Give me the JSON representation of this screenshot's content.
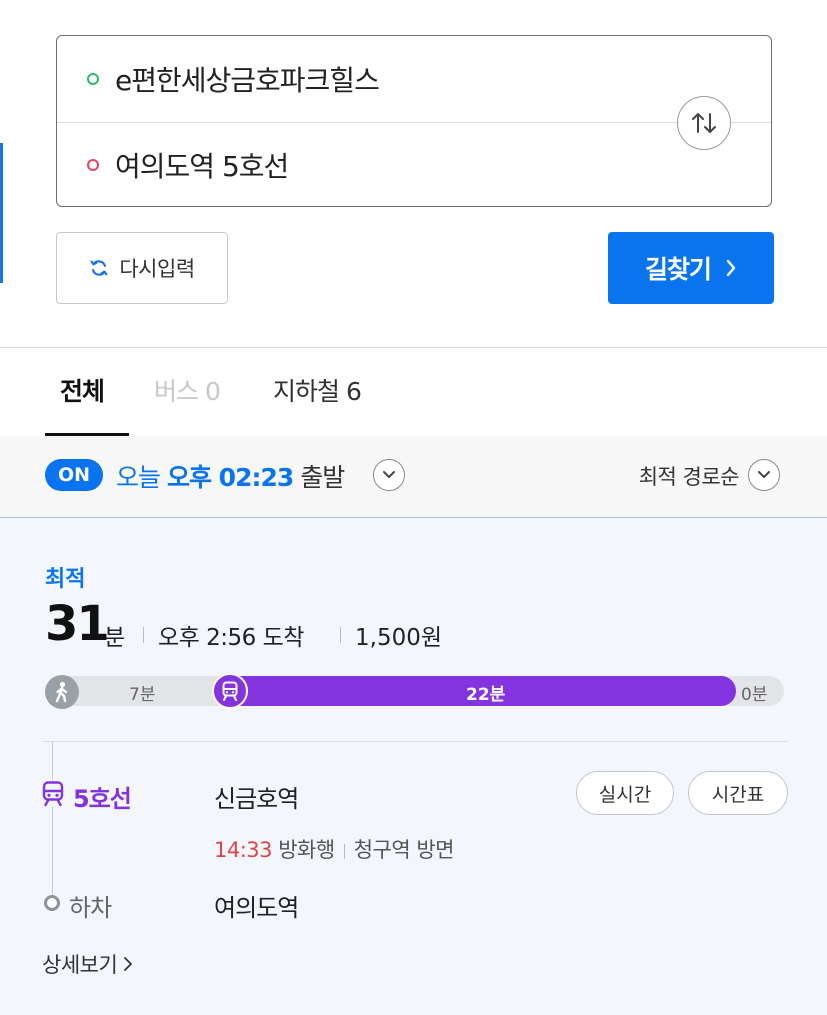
{
  "search": {
    "origin": "e편한세상금호파크힐스",
    "destination": "여의도역 5호선"
  },
  "actions": {
    "reset_label": "다시입력",
    "find_label": "길찾기"
  },
  "tabs": [
    {
      "label": "전체",
      "active": true
    },
    {
      "label": "버스 0",
      "active": false
    },
    {
      "label": "지하철 6",
      "active": false
    }
  ],
  "filter": {
    "on_badge": "ON",
    "today": "오늘",
    "departure_time": "오후 02:23",
    "depart_suffix": "출발",
    "sort_label": "최적 경로순"
  },
  "route": {
    "badge": "최적",
    "duration": "31",
    "duration_unit": "분",
    "arrival": "오후 2:56 도착",
    "fare": "1,500원",
    "segments": {
      "walk": "7분",
      "subway": "22분",
      "end": "0분"
    },
    "line_name": "5호선",
    "board_station": "신금호역",
    "realtime_label": "실시간",
    "timetable_label": "시간표",
    "depart_time": "14:33",
    "bound_for": "방화행",
    "direction": "청구역 방면",
    "alight_label": "하차",
    "alight_station": "여의도역",
    "detail_label": "상세보기",
    "line_color": "#8434de"
  },
  "colors": {
    "accent_blue": "#0a74ee",
    "line5_purple": "#8434de",
    "time_red": "#e04545"
  }
}
